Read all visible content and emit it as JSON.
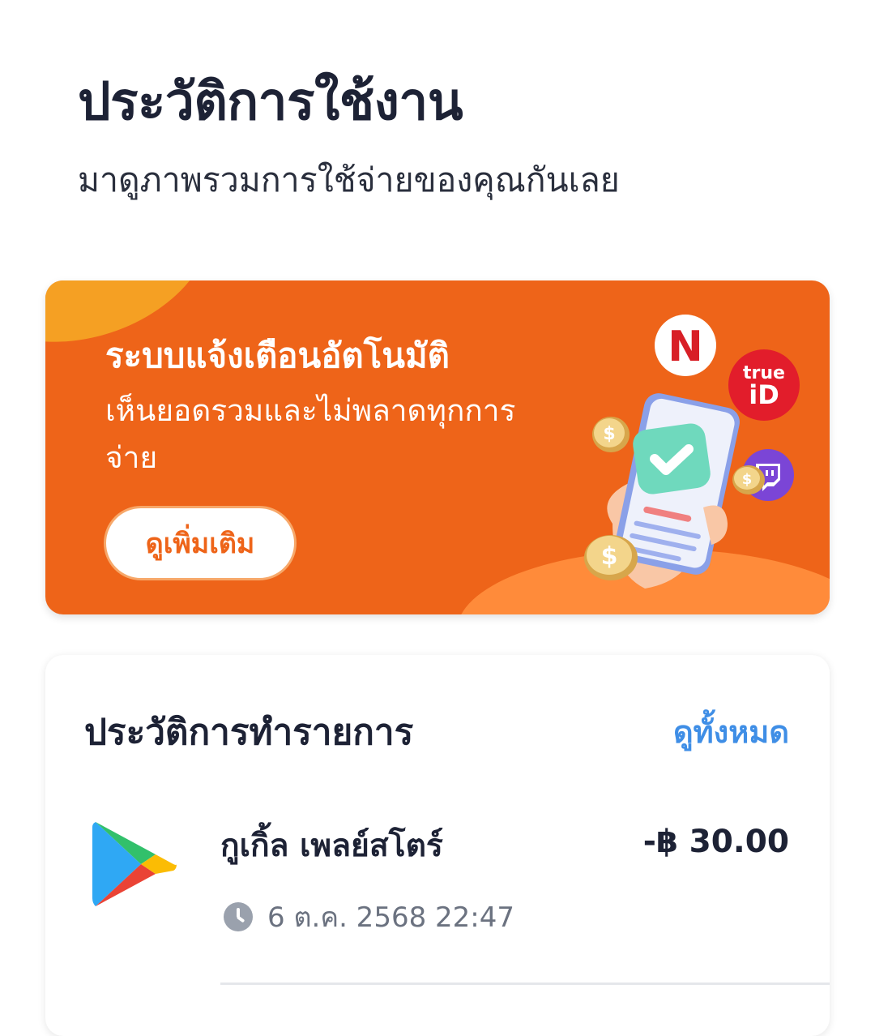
{
  "header": {
    "title": "ประวัติการใช้งาน",
    "subtitle": "มาดูภาพรวมการใช้จ่ายของคุณกันเลย"
  },
  "banner": {
    "title": "ระบบแจ้งเตือนอัตโนมัติ",
    "body": "เห็นยอดรวมและไม่พลาดทุกการจ่าย",
    "button_label": "ดูเพิ่มเติม",
    "icons": [
      "netflix-logo",
      "trueid-logo",
      "twitch-logo",
      "phone-check-illustration",
      "coin-icon"
    ],
    "logo_text": {
      "netflix": "N",
      "trueid_top": "true",
      "trueid_bottom": "iD"
    }
  },
  "transactions": {
    "title": "ประวัติการทำรายการ",
    "view_all_label": "ดูทั้งหมด",
    "items": [
      {
        "icon": "google-play-icon",
        "name": "กูเกิ้ล เพลย์สโตร์",
        "amount": "-฿ 30.00",
        "datetime": "6 ต.ค. 2568 22:47"
      }
    ]
  },
  "colors": {
    "banner_orange": "#ee6419",
    "accent_blue": "#3f8ee6",
    "text_dark": "#1d2235"
  }
}
